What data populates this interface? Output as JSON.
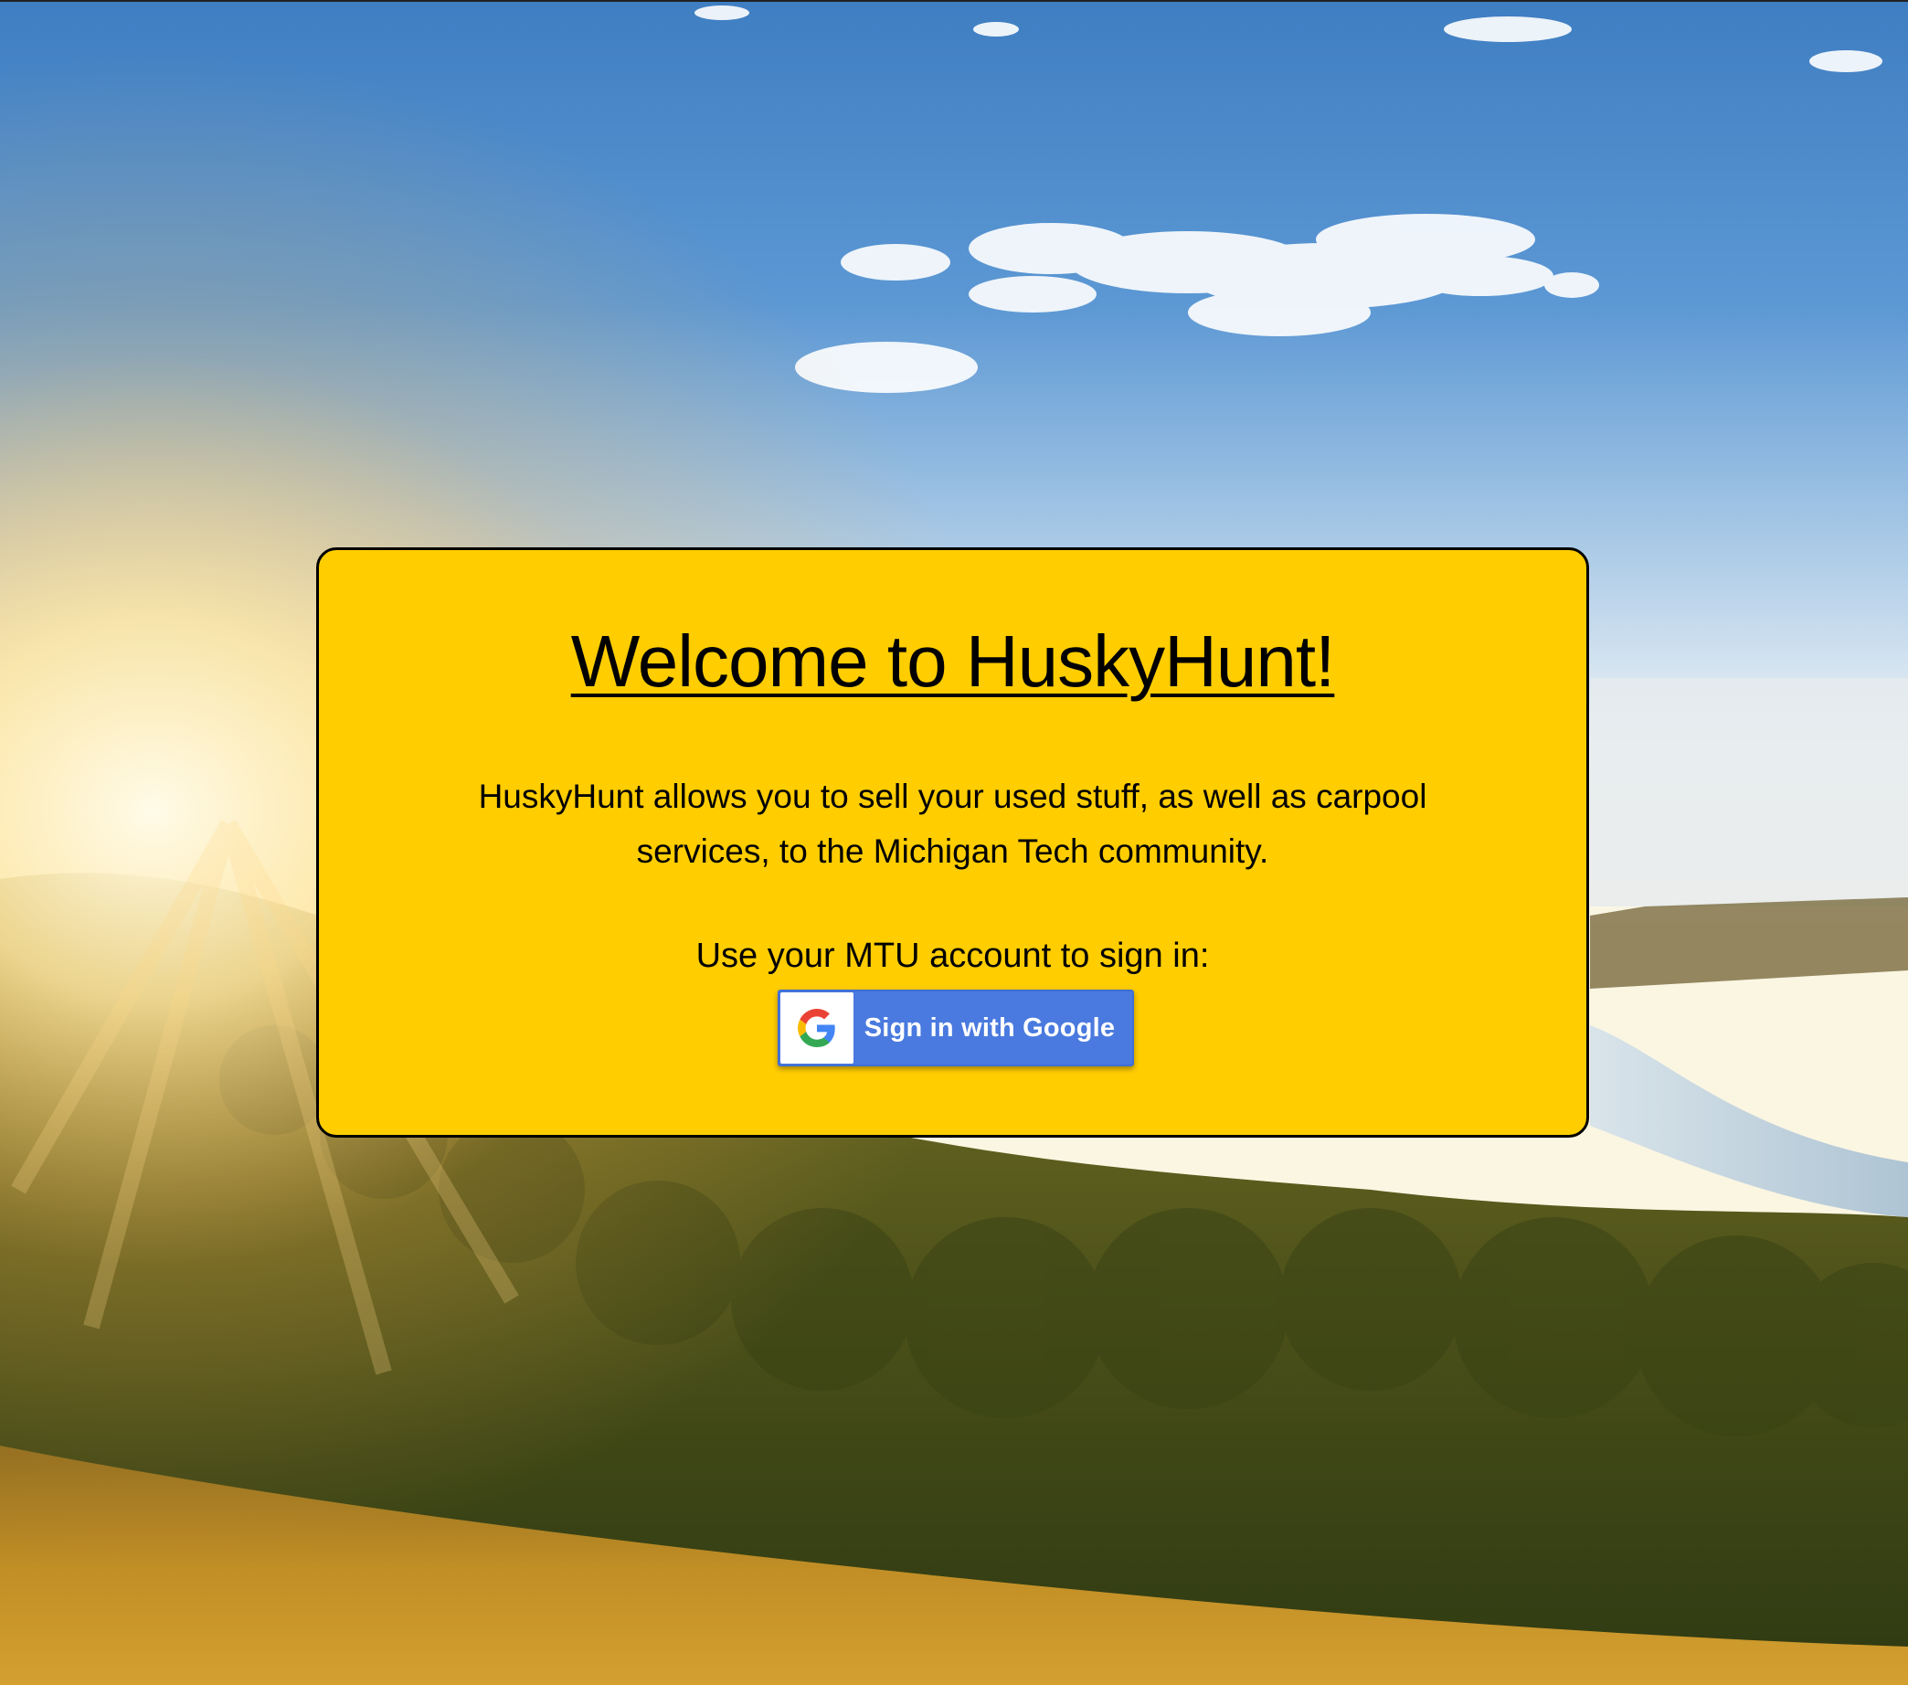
{
  "background": {
    "image": "scenic-landscape-photo",
    "description_colors": {
      "sky_top": "#4a86c8",
      "horizon": "#f3f6f2",
      "hills": "#6a6a20",
      "field": "#c89a2a",
      "water": "#c8d8e4"
    }
  },
  "card": {
    "background_color": "#ffcd00",
    "title": "Welcome to HuskyHunt!",
    "description": "HuskyHunt allows you to sell your used stuff, as well as carpool services, to the Michigan Tech community.",
    "signin_prompt": "Use your MTU account to sign in:",
    "google_button": {
      "label": "Sign in with Google",
      "icon": "google-g-icon",
      "color": "#4a7adf"
    }
  }
}
